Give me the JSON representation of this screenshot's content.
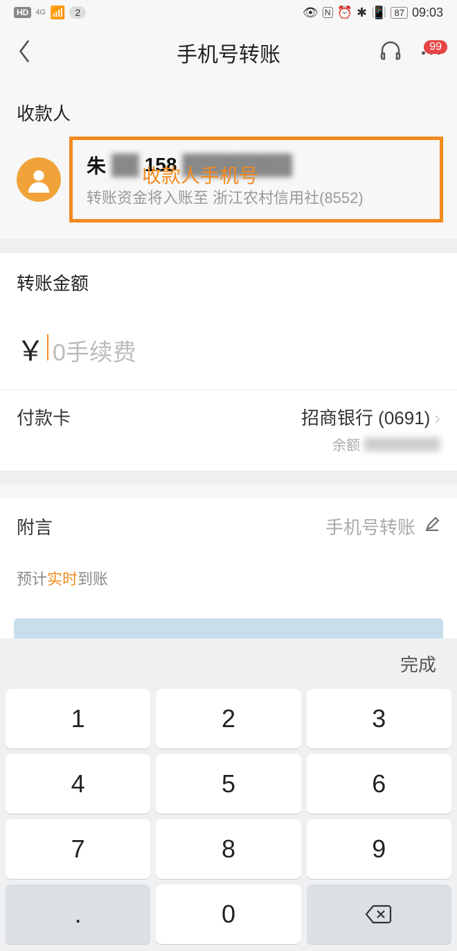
{
  "statusBar": {
    "hd": "HD",
    "net": "4G",
    "signal_count": "2",
    "battery": "87",
    "time": "09:03"
  },
  "nav": {
    "title": "手机号转账",
    "badge": "99"
  },
  "payee": {
    "section": "收款人",
    "name_prefix": "朱",
    "phone_prefix": "158",
    "annotation": "收款人手机号",
    "subtitle": "转账资金将入账至 浙江农村信用社(8552)"
  },
  "amount": {
    "section": "转账金额",
    "symbol": "￥",
    "placeholder": "0手续费"
  },
  "card": {
    "label": "付款卡",
    "name": "招商银行 (0691)",
    "balance_label": "余额"
  },
  "note": {
    "label": "附言",
    "value": "手机号转账"
  },
  "arrival": {
    "prefix": "预计",
    "mid": "实时",
    "suffix": "到账"
  },
  "keyboard": {
    "done": "完成",
    "keys": [
      "1",
      "2",
      "3",
      "4",
      "5",
      "6",
      "7",
      "8",
      "9"
    ],
    "zero": "0",
    "dot": "."
  }
}
